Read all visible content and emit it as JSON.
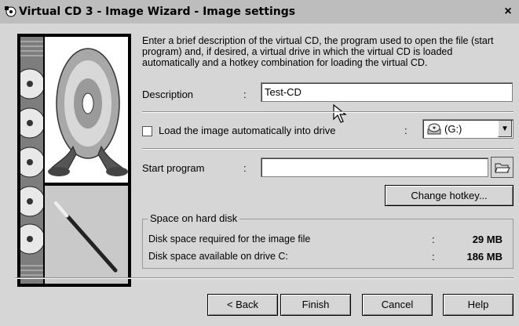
{
  "window": {
    "title": "Virtual CD 3 - Image Wizard - Image settings",
    "close_label": "×"
  },
  "intro": {
    "text": "Enter a brief description of the virtual CD, the program used to open the file (start program) and, if desired, a virtual drive in which the virtual CD is loaded automatically and a hotkey combination for loading the virtual CD."
  },
  "description": {
    "label": "Description",
    "colon": ":",
    "value": "Test-CD"
  },
  "load_drive": {
    "label": "Load the image automatically into drive",
    "colon": ":",
    "checked": false,
    "drive": "(G:)"
  },
  "start_program": {
    "label": "Start program",
    "colon": ":",
    "value": ""
  },
  "change_hotkey_label": "Change hotkey...",
  "space": {
    "title": "Space on hard disk",
    "rows": [
      {
        "label": "Disk space required for the image file",
        "colon": ":",
        "value": "29 MB"
      },
      {
        "label": "Disk space available on drive C:",
        "colon": ":",
        "value": "186 MB"
      }
    ]
  },
  "buttons": {
    "back": "< Back",
    "finish": "Finish",
    "cancel": "Cancel",
    "help": "Help"
  }
}
